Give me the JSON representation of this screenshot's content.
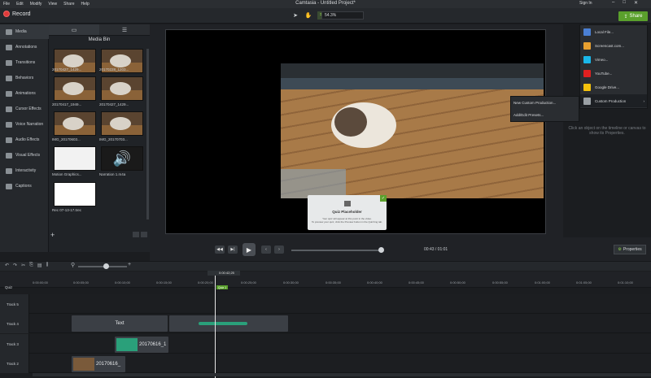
{
  "menubar": {
    "items": [
      "File",
      "Edit",
      "Modify",
      "View",
      "Share",
      "Help"
    ],
    "title": "Camtasia - Untitled Project*",
    "signin": "Sign In",
    "controls": [
      "–",
      "□",
      "✕"
    ]
  },
  "toolbar": {
    "record_label": "Record",
    "zoom_value": "54.3%",
    "share_label": "Share"
  },
  "sidebar": {
    "items": [
      {
        "label": "Media",
        "icon": "media-icon"
      },
      {
        "label": "Annotations",
        "icon": "annotations-icon"
      },
      {
        "label": "Transitions",
        "icon": "transitions-icon"
      },
      {
        "label": "Behaviors",
        "icon": "behaviors-icon"
      },
      {
        "label": "Animations",
        "icon": "animations-icon"
      },
      {
        "label": "Cursor Effects",
        "icon": "cursor-icon"
      },
      {
        "label": "Voice Narration",
        "icon": "mic-icon"
      },
      {
        "label": "Audio Effects",
        "icon": "audio-icon"
      },
      {
        "label": "Visual Effects",
        "icon": "visual-icon"
      },
      {
        "label": "Interactivity",
        "icon": "interactivity-icon"
      },
      {
        "label": "Captions",
        "icon": "captions-icon"
      }
    ]
  },
  "bin": {
    "title": "Media Bin",
    "items": [
      {
        "label": "20170427_1429..."
      },
      {
        "label": "20170228_1203..."
      },
      {
        "label": "20170417_1949..."
      },
      {
        "label": "20170427_1429..."
      },
      {
        "label": "IMG_20170603..."
      },
      {
        "label": "IMG_20170703..."
      },
      {
        "label": "Motion Graphics..."
      },
      {
        "label": "Narration 1.m4a"
      },
      {
        "label": "Rec 07-13-17.trec"
      }
    ]
  },
  "quiz": {
    "title": "Quiz Placeholder",
    "line1": "Your quiz will appear at this point in the video.",
    "line2": "To preview your quiz, click the Preview button in the Quizzing tab."
  },
  "playback": {
    "time": "00:43 / 01:01",
    "properties_label": "Properties"
  },
  "hint": "Click an object on the timeline or canvas to show its Properties.",
  "share_menu": {
    "items": [
      {
        "label": "Local File...",
        "color": "#4a7fd4"
      },
      {
        "label": "Screencast.com...",
        "color": "#e8a030"
      },
      {
        "label": "Vimeo...",
        "color": "#1ab7ea"
      },
      {
        "label": "YouTube...",
        "color": "#e02020"
      },
      {
        "label": "Google Drive...",
        "color": "#f4c20d"
      },
      {
        "label": "Custom Production",
        "color": "#9aa0a5"
      }
    ],
    "submenu": [
      "New Custom Production...",
      "Add/Edit Presets..."
    ]
  },
  "timeline": {
    "playhead_time": "0:00:42;25",
    "quiz_marker": "Quiz 1",
    "quiz_label": "Quiz",
    "ticks": [
      "0:00:00;00",
      "0:00:05;00",
      "0:00:10;00",
      "0:00:15;00",
      "0:00:20;00",
      "0:00:25;00",
      "0:00:30;00",
      "0:00:35;00",
      "0:00:40;00",
      "0:00:45;00",
      "0:00:50;00",
      "0:00:55;00",
      "0:01:00;00",
      "0:01:05;00",
      "0:01:10;00",
      "0:01:15;00"
    ],
    "tracks": [
      "Track 5",
      "Track 4",
      "Track 3",
      "Track 2"
    ],
    "clips": {
      "text": "Text",
      "vid1": "20170616_1",
      "vid2": "20170616_"
    }
  }
}
